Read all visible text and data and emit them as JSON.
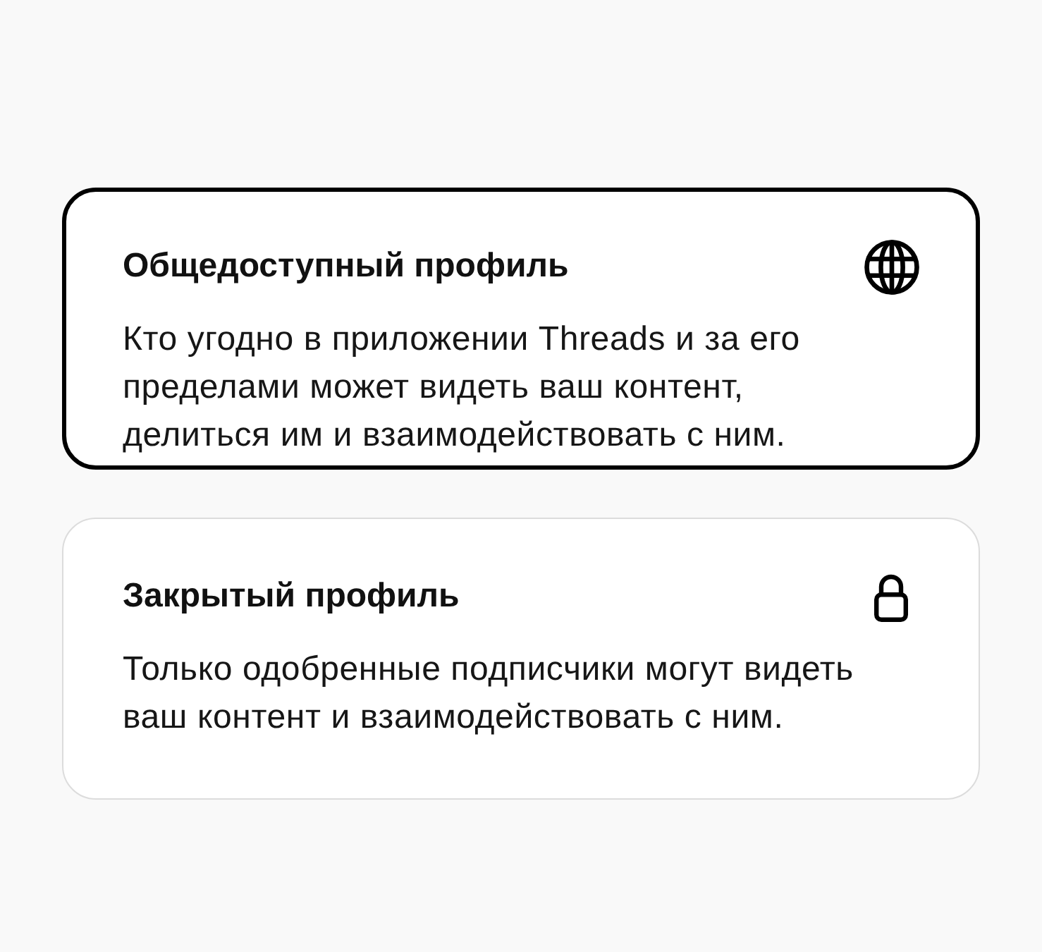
{
  "options": [
    {
      "kind": "public",
      "title": "Общедоступный профиль",
      "description": "Кто угодно в приложении Threads и за его пределами может видеть ваш контент, делиться им и взаимодействовать с ним.",
      "selected": true
    },
    {
      "kind": "private",
      "title": "Закрытый профиль",
      "description": "Только одобренные подписчики могут видеть ваш контент и взаимодействовать с ним.",
      "selected": false
    }
  ]
}
